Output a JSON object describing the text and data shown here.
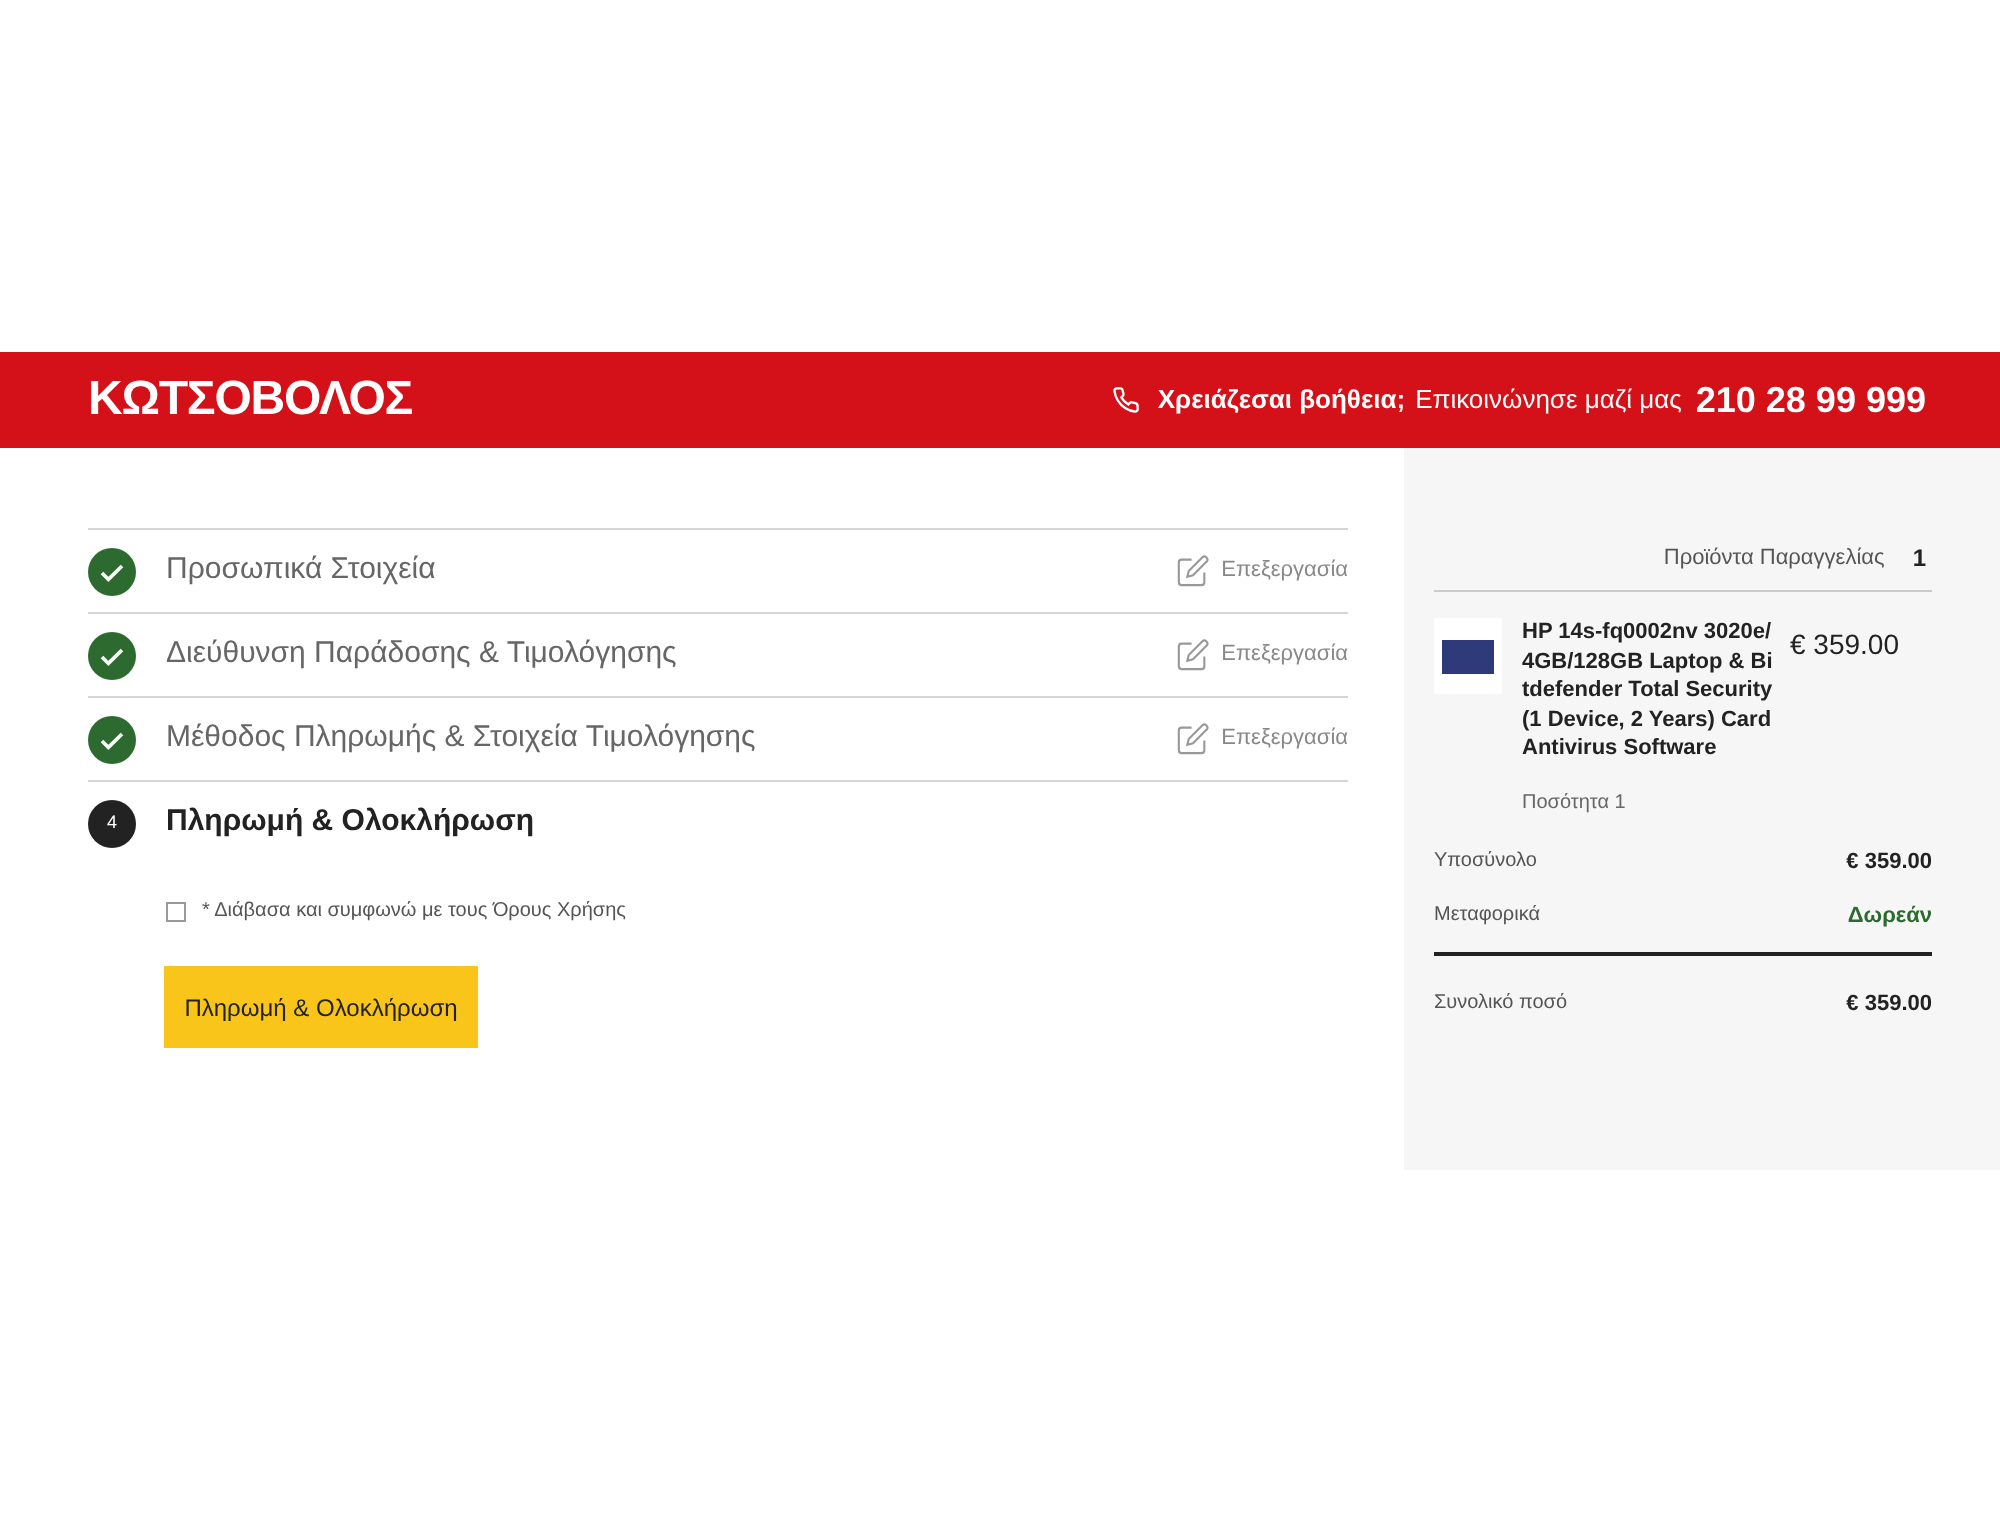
{
  "header": {
    "logo": "ΚΩΤΣΟΒΟΛΟΣ",
    "help_question": "Χρειάζεσαι βοήθεια;",
    "help_text": "Επικοινώνησε μαζί μας",
    "phone": "210 28 99 999"
  },
  "steps": [
    {
      "kind": "done",
      "title": "Προσωπικά Στοιχεία",
      "edit": "Επεξεργασία"
    },
    {
      "kind": "done",
      "title": "Διεύθυνση Παράδοσης & Τιμολόγησης",
      "edit": "Επεξεργασία"
    },
    {
      "kind": "done",
      "title": "Μέθοδος Πληρωμής & Στοιχεία Τιμολόγησης",
      "edit": "Επεξεργασία"
    },
    {
      "kind": "current",
      "number": "4",
      "title": "Πληρωμή & Ολοκλήρωση"
    }
  ],
  "terms": {
    "label": "* Διάβασα και συμφωνώ με τους Όρους Χρήσης",
    "checked": false
  },
  "submit_button": "Πληρωμή & Ολοκλήρωση",
  "summary": {
    "heading": "Προϊόντα Παραγγελίας",
    "count": "1",
    "product": {
      "name": "HP 14s-fq0002nv 3020e/4GB/128GB Laptop & Bitdefender Total Security (1 Device, 2 Years) Card Antivirus Software",
      "price": "€ 359.00",
      "quantity": "Ποσότητα 1"
    },
    "lines": [
      {
        "label": "Υποσύνολο",
        "value": "€ 359.00",
        "kind": "normal"
      },
      {
        "label": "Μεταφορικά",
        "value": "Δωρεάν",
        "kind": "free"
      }
    ],
    "total": {
      "label": "Συνολικό ποσό",
      "value": "€ 359.00"
    }
  }
}
